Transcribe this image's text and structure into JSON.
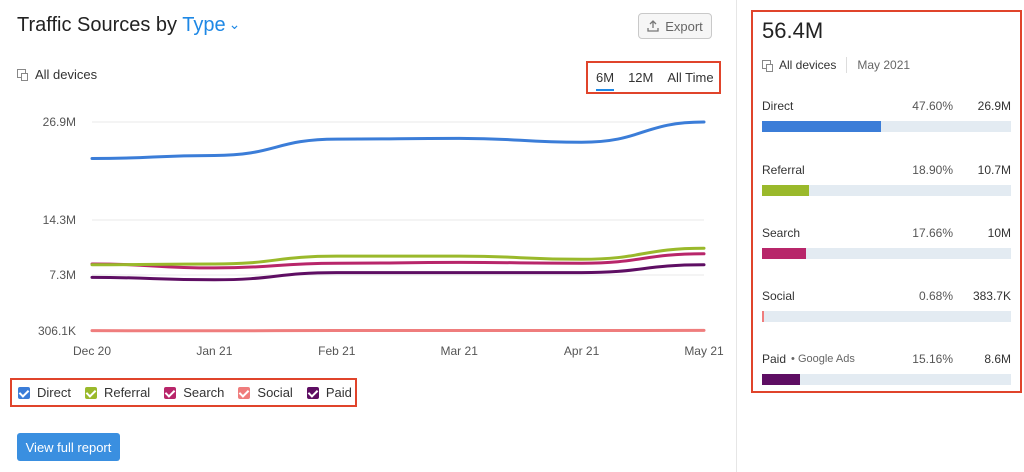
{
  "header": {
    "title_prefix": "Traffic Sources by",
    "title_type": "Type",
    "export_label": "Export",
    "devices_label": "All devices"
  },
  "periods": [
    {
      "label": "6M",
      "active": true
    },
    {
      "label": "12M",
      "active": false
    },
    {
      "label": "All Time",
      "active": false
    }
  ],
  "legend": [
    {
      "label": "Direct",
      "color": "#3b7dd8"
    },
    {
      "label": "Referral",
      "color": "#9ab92b"
    },
    {
      "label": "Search",
      "color": "#b8266a"
    },
    {
      "label": "Social",
      "color": "#ef7d7d"
    },
    {
      "label": "Paid",
      "color": "#5e0e63"
    }
  ],
  "buttons": {
    "full_report": "View full report"
  },
  "chart_data": {
    "type": "line",
    "categories": [
      "Dec 20",
      "Jan 21",
      "Feb 21",
      "Mar 21",
      "Apr 21",
      "May 21"
    ],
    "y_ticks": [
      {
        "label": "26.9M",
        "value": 26.9
      },
      {
        "label": "14.3M",
        "value": 14.3
      },
      {
        "label": "7.3M",
        "value": 7.3
      },
      {
        "label": "306.1K",
        "value": 0.3061
      }
    ],
    "series": [
      {
        "name": "Direct",
        "color": "#3b7dd8",
        "values": [
          22.2,
          22.6,
          24.7,
          24.8,
          24.3,
          26.9
        ]
      },
      {
        "name": "Referral",
        "color": "#9ab92b",
        "values": [
          8.6,
          8.7,
          9.7,
          9.7,
          9.3,
          10.7
        ]
      },
      {
        "name": "Search",
        "color": "#b8266a",
        "values": [
          8.7,
          8.2,
          8.8,
          8.9,
          8.8,
          10.0
        ]
      },
      {
        "name": "Social",
        "color": "#ef7d7d",
        "values": [
          0.35,
          0.33,
          0.37,
          0.37,
          0.37,
          0.38
        ]
      },
      {
        "name": "Paid",
        "color": "#5e0e63",
        "values": [
          7.0,
          6.7,
          7.6,
          7.6,
          7.6,
          8.6
        ]
      }
    ]
  },
  "summary": {
    "total": "56.4M",
    "devices_label": "All devices",
    "month": "May 2021",
    "rows": [
      {
        "label": "Direct",
        "sub": "",
        "pct": "47.60%",
        "value": "26.9M",
        "share": 0.476,
        "color": "#3b7dd8"
      },
      {
        "label": "Referral",
        "sub": "",
        "pct": "18.90%",
        "value": "10.7M",
        "share": 0.189,
        "color": "#9ab92b"
      },
      {
        "label": "Search",
        "sub": "",
        "pct": "17.66%",
        "value": "10M",
        "share": 0.1766,
        "color": "#b8266a"
      },
      {
        "label": "Social",
        "sub": "",
        "pct": "0.68%",
        "value": "383.7K",
        "share": 0.0068,
        "color": "#ef7d7d"
      },
      {
        "label": "Paid",
        "sub": "Google Ads",
        "pct": "15.16%",
        "value": "8.6M",
        "share": 0.1516,
        "color": "#5e0e63"
      }
    ]
  }
}
